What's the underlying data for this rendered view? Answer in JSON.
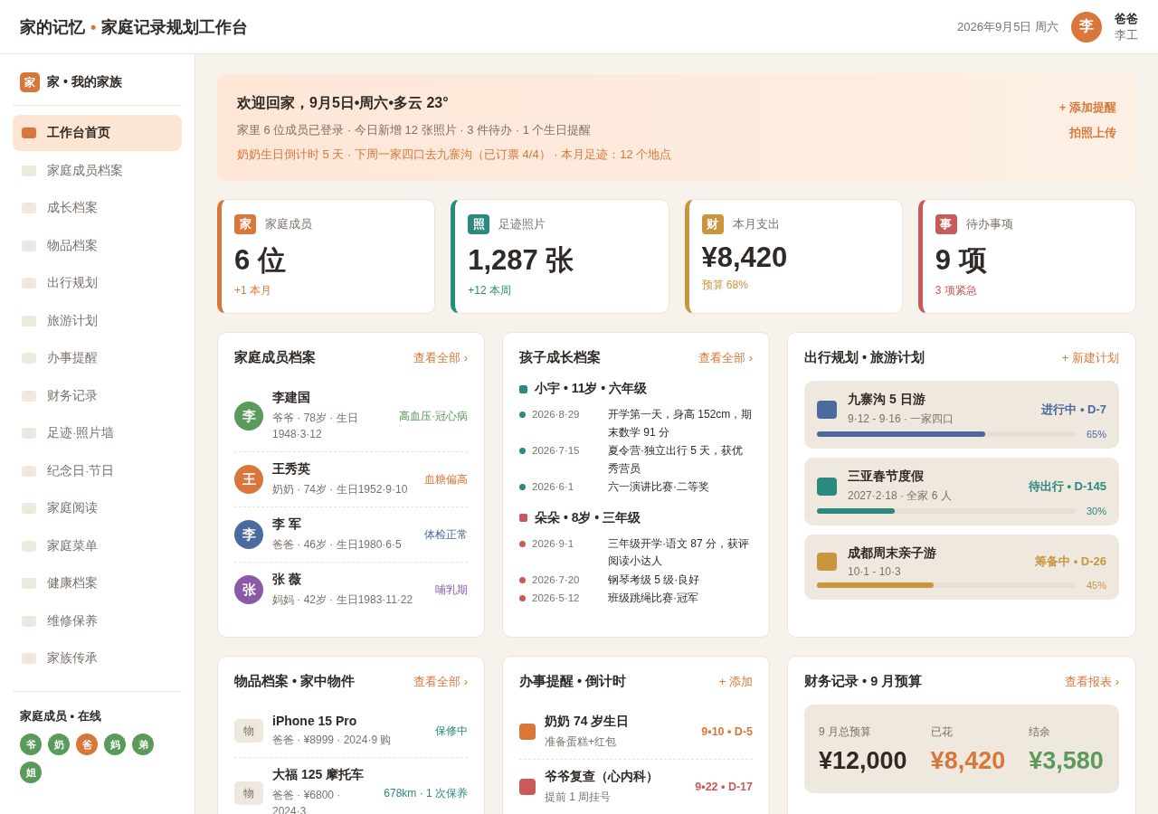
{
  "header": {
    "title": {
      "name": "家的记忆",
      "separator": "•",
      "subtitle": "家庭记录规划工作台"
    },
    "date": "2026年9月5日 周六",
    "user": {
      "avatar": "李",
      "name": "爸爸",
      "sub": "李工"
    }
  },
  "sidebar": {
    "brand": {
      "icon": "家",
      "label": "家 • 我的家族"
    },
    "items": [
      {
        "label": "工作台首页",
        "selected": true
      },
      {
        "label": "家庭成员档案",
        "selected": false
      },
      {
        "label": "成长档案",
        "selected": false
      },
      {
        "label": "物品档案",
        "selected": false
      },
      {
        "label": "出行规划",
        "selected": false
      },
      {
        "label": "旅游计划",
        "selected": false
      },
      {
        "label": "办事提醒",
        "selected": false
      },
      {
        "label": "财务记录",
        "selected": false
      },
      {
        "label": "足迹·照片墙",
        "selected": false
      },
      {
        "label": "纪念日·节日",
        "selected": false
      },
      {
        "label": "家庭阅读",
        "selected": false
      },
      {
        "label": "家庭菜单",
        "selected": false
      },
      {
        "label": "健康档案",
        "selected": false
      },
      {
        "label": "维修保养",
        "selected": false
      },
      {
        "label": "家族传承",
        "selected": false
      }
    ],
    "online_title": "家庭成员 • 在线",
    "online": [
      {
        "label": "爷",
        "color": "#5a9a5a"
      },
      {
        "label": "奶",
        "color": "#5a9a5a"
      },
      {
        "label": "爸",
        "color": "#d9773a"
      },
      {
        "label": "妈",
        "color": "#5a9a5a"
      },
      {
        "label": "弟",
        "color": "#5a9a5a"
      },
      {
        "label": "姐",
        "color": "#5a9a5a"
      }
    ]
  },
  "banner": {
    "title": "欢迎回家，9月5日•周六•多云 23°",
    "line": "家里 6 位成员已登录 · 今日新增 12 张照片 · 3 件待办 · 1 个生日提醒",
    "highlight": "奶奶生日倒计时 5 天 · 下周一家四口去九寨沟（已订票 4/4） · 本月足迹：12 个地点",
    "actions": [
      "+ 添加提醒",
      "拍照上传"
    ]
  },
  "stats": [
    {
      "icon": "家",
      "label": "家庭成员",
      "value": "6 位",
      "delta": "+1 本月",
      "color": "#d9773a"
    },
    {
      "icon": "照",
      "label": "足迹照片",
      "value": "1,287 张",
      "delta": "+12 本周",
      "color": "#2a8a7e"
    },
    {
      "icon": "财",
      "label": "本月支出",
      "value": "¥8,420",
      "delta": "预算 68%",
      "color": "#c9963f"
    },
    {
      "icon": "事",
      "label": "待办事项",
      "value": "9 项",
      "delta": "3 项紧急",
      "color": "#c85a5a"
    }
  ],
  "members": {
    "title": "家庭成员档案",
    "action": "查看全部 ›",
    "rows": [
      {
        "avatar": "李",
        "name": "李建国",
        "meta": "爷爷 · 78岁 · 生日1948·3·12",
        "tag": "高血压·冠心病",
        "color": "#5a9a5a"
      },
      {
        "avatar": "王",
        "name": "王秀英",
        "meta": "奶奶 · 74岁 · 生日1952·9·10",
        "tag": "血糖偏高",
        "color": "#d9773a"
      },
      {
        "avatar": "李",
        "name": "李 军",
        "meta": "爸爸 · 46岁 · 生日1980·6·5",
        "tag": "体检正常",
        "color": "#4a6aa0"
      },
      {
        "avatar": "张",
        "name": "张 薇",
        "meta": "妈妈 · 42岁 · 生日1983·11·22",
        "tag": "哺乳期",
        "color": "#8a5aa8"
      }
    ]
  },
  "growth": {
    "title": "孩子成长档案",
    "action": "查看全部 ›",
    "children": [
      {
        "name": "小宇 • 11岁 • 六年级",
        "color": "#2a8a7e",
        "entries": [
          {
            "date": "2026·8·29",
            "text": "开学第一天，身高 152cm，期末数学 91 分"
          },
          {
            "date": "2026·7·15",
            "text": "夏令营·独立出行 5 天，获优秀营员"
          },
          {
            "date": "2026·6·1",
            "text": "六一演讲比赛·二等奖"
          }
        ]
      },
      {
        "name": "朵朵 • 8岁 • 三年级",
        "color": "#c85a5a",
        "entries": [
          {
            "date": "2026·9·1",
            "text": "三年级开学·语文 87 分，获评阅读小达人"
          },
          {
            "date": "2026·7·20",
            "text": "钢琴考级 5 级·良好"
          },
          {
            "date": "2026·5·12",
            "text": "班级跳绳比赛·冠军"
          }
        ]
      }
    ]
  },
  "trips": {
    "title": "出行规划 • 旅游计划",
    "action": "+ 新建计划",
    "items": [
      {
        "name": "九寨沟 5 日游",
        "meta": "9·12 - 9·16 · 一家四口",
        "status": "进行中 • D-7",
        "level": 0.65,
        "percent": "65%",
        "color": "#4a6aa0"
      },
      {
        "name": "三亚春节度假",
        "meta": "2027·2·18 · 全家 6 人",
        "status": "待出行 • D-145",
        "level": 0.3,
        "percent": "30%",
        "color": "#2a8a7e"
      },
      {
        "name": "成都周末亲子游",
        "meta": "10·1 - 10·3",
        "status": "筹备中 • D-26",
        "level": 0.45,
        "percent": "45%",
        "color": "#c9963f"
      }
    ]
  },
  "things": {
    "title": "物品档案 • 家中物件",
    "action": "查看全部 ›",
    "items": [
      {
        "icon": "物",
        "name": "iPhone 15 Pro",
        "meta": "爸爸 · ¥8999 · 2024·9 购",
        "status": "保修中"
      },
      {
        "icon": "物",
        "name": "大福 125 摩托车",
        "meta": "爸爸 · ¥6800 · 2024·3",
        "status": "678km · 1 次保养"
      }
    ]
  },
  "reminders": {
    "title": "办事提醒 • 倒计时",
    "action": "+ 添加",
    "items": [
      {
        "title": "奶奶 74 岁生日",
        "sub": "准备蛋糕+红包",
        "due": "9•10 • D-5",
        "color": "#d9773a"
      },
      {
        "title": "爷爷复查（心内科）",
        "sub": "提前 1 周挂号",
        "due": "9•22 • D-17",
        "color": "#c85a5a"
      }
    ]
  },
  "finance": {
    "title": "财务记录 • 9 月预算",
    "action": "查看报表 ›",
    "summary": [
      {
        "label": "9 月总预算",
        "value": "¥12,000",
        "color": "#2f2a26"
      },
      {
        "label": "已花",
        "value": "¥8,420",
        "color": "#d9773a"
      },
      {
        "label": "结余",
        "value": "¥3,580",
        "color": "#5a9a5a"
      }
    ]
  }
}
